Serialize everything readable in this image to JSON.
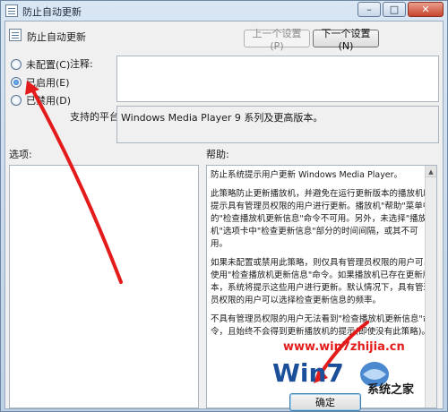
{
  "window": {
    "title": "防止自动更新",
    "controls": [
      "minimize",
      "maximize",
      "close"
    ]
  },
  "header": {
    "title": "防止自动更新",
    "prev_label": "上一个设置(P)",
    "next_label": "下一个设置(N)"
  },
  "options": {
    "not_configured": "未配置(C)",
    "enabled": "已启用(E)",
    "disabled": "已禁用(D)",
    "selected": "enabled"
  },
  "comment": {
    "label": "注释:",
    "value": ""
  },
  "platform": {
    "label": "支持的平台:",
    "value": "Windows Media Player 9 系列及更高版本。"
  },
  "panes": {
    "options_label": "选项:",
    "help_label": "帮助:"
  },
  "help": {
    "paragraphs": [
      "防止系统提示用户更新 Windows Media Player。",
      "此策略防止更新播放机，并避免在运行更新版本的播放机时提示具有管理员权限的用户进行更新。播放机\"帮助\"菜单中的\"检查播放机更新信息\"命令不可用。另外，未选择\"播放机\"选项卡中\"检查更新信息\"部分的时间间隔，或其不可用。",
      "如果未配置或禁用此策略，则仅具有管理员权限的用户可以使用\"检查播放机更新信息\"命令。如果播放机已存在更新版本，系统将提示这些用户进行更新。默认情况下，具有管理员权限的用户可以选择检查更新信息的频率。",
      "不具有管理员权限的用户无法看到\"检查播放机更新信息\"命令，且始终不会得到更新播放机的提示(即使没有此策略)。"
    ]
  },
  "footer": {
    "ok_label": "确定"
  },
  "watermark": {
    "url": "www.win7zhijia.cn",
    "logo_text": "Win7",
    "brand": "系统之家"
  },
  "colors": {
    "annotation": "#e31b1b",
    "title_bar": "#c9d7e6",
    "client_bg": "#f0f0f0"
  }
}
